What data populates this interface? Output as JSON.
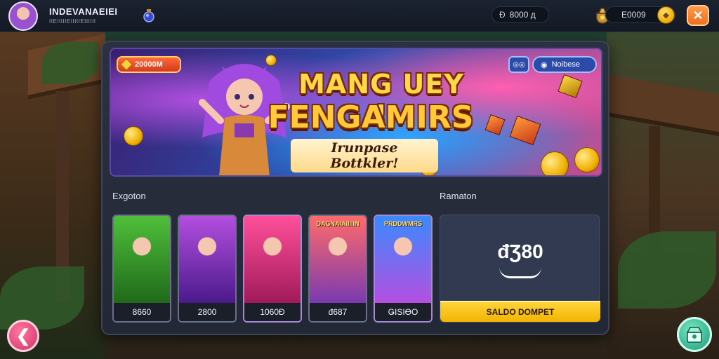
{
  "header": {
    "player_name": "INDEVANAEIEI",
    "player_subtitle": "IIEIIIIIEIIIIIEIIIIII",
    "mid_counter": "8000 д",
    "mid_glyph": "Đ",
    "gold_amount": "E0009",
    "coin_glyph": "◆",
    "close_glyph": "✕"
  },
  "banner": {
    "chip_value": "20000M",
    "title_line1": "MANG UEY !",
    "title_line2": "FENGAMIRS",
    "subtitle": "Irunpase Bottkler!",
    "button_a_label": "◎◎",
    "button_b_label": "Noibese"
  },
  "sections": {
    "left_label": "Exgoton",
    "right_label": "Ramaton"
  },
  "cards": [
    {
      "value": "8660",
      "tag": "",
      "colors": [
        "#4fbf3a",
        "#1f6a1a"
      ],
      "border": "#6a6f8a"
    },
    {
      "value": "2800",
      "tag": "",
      "colors": [
        "#b44fe0",
        "#4a1a8a"
      ],
      "border": "#6a6f8a"
    },
    {
      "value": "1060Đ",
      "tag": "",
      "colors": [
        "#ff4f9a",
        "#a01a5a"
      ],
      "border": "#a48acf"
    },
    {
      "value": "đ687",
      "tag": "DAGNAIAIIIIIN",
      "colors": [
        "#ff6a6a",
        "#7a3ab0"
      ],
      "border": "#6a6f8a"
    },
    {
      "value": "ǤISIӨO",
      "tag": "PRDDWMRS",
      "colors": [
        "#3a8aff",
        "#b44fe0"
      ],
      "border": "#a48acf"
    }
  ],
  "balance": {
    "value": "đƷ80",
    "wallet_button": "SALDO DOMPET"
  },
  "nav": {
    "back_glyph": "❮"
  },
  "colors": {
    "accent_gold": "#ffd43a",
    "close_orange": "#f0701c",
    "back_pink": "#d2306a",
    "shop_green": "#1a9a7a"
  }
}
